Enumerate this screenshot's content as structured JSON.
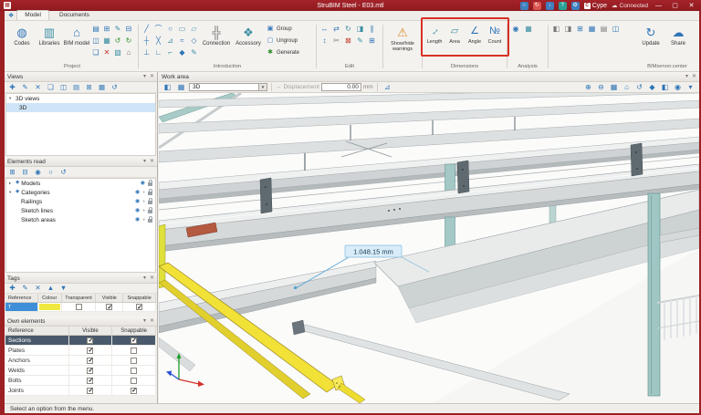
{
  "window": {
    "title": "StruBIM Steel - E03.mtl",
    "brand": "Cype",
    "connection": "Connected",
    "minimize": "—",
    "maximize": "▢",
    "close": "✕"
  },
  "tabs": {
    "model": "Model",
    "documents": "Documents"
  },
  "icons": {
    "codes": "◍",
    "libraries": "▥",
    "bim_model": "⌂",
    "connection": "╬",
    "accessory": "❖",
    "group": "▣",
    "ungroup": "▢",
    "generate": "✱",
    "warnings": "⚠",
    "length": "↔",
    "area": "▱",
    "angle": "∠",
    "count": "№",
    "update": "↻",
    "share": "☁"
  },
  "ribbon": {
    "project": {
      "label": "Project",
      "codes": "Codes",
      "libraries": "Libraries",
      "bim_model": "BIM model"
    },
    "introduction": {
      "label": "Introduction",
      "connection": "Connection",
      "accessory": "Accessory",
      "group": "Group",
      "ungroup": "Ungroup",
      "generate": "Generate"
    },
    "edit": {
      "label": "Edit"
    },
    "warnings": {
      "label": "Show/hide warnings"
    },
    "dimensions": {
      "label": "Dimensions",
      "length": "Length",
      "area": "Area",
      "angle": "Angle",
      "count": "Count",
      "highlight_color": "#d93025"
    },
    "analysis": {
      "label": "Analysis"
    },
    "bimserver": {
      "label": "BIMserver.center",
      "update": "Update",
      "share": "Share"
    }
  },
  "views_panel": {
    "title": "Views",
    "group_label": "3D views",
    "item_3d": "3D"
  },
  "elements_read_panel": {
    "title": "Elements read",
    "models": "Models",
    "categories": "Categories",
    "children": [
      "Railings",
      "Sketch lines",
      "Sketch areas"
    ]
  },
  "tags_panel": {
    "title": "Tags",
    "columns": [
      "Reference",
      "Colour",
      "Transparent",
      "Visible",
      "Snappable"
    ],
    "row": {
      "reference": "T",
      "colour": "#f0e840",
      "transparent": false,
      "visible": true,
      "snappable": true
    }
  },
  "own_elements_panel": {
    "title": "Own elements",
    "columns": [
      "Reference",
      "Visible",
      "Snappable"
    ],
    "rows": [
      {
        "reference": "Sections",
        "visible": true,
        "snappable": true,
        "selected": true
      },
      {
        "reference": "Plates",
        "visible": true,
        "snappable": false
      },
      {
        "reference": "Anchors",
        "visible": true,
        "snappable": false
      },
      {
        "reference": "Welds",
        "visible": true,
        "snappable": false
      },
      {
        "reference": "Bolts",
        "visible": true,
        "snappable": false
      },
      {
        "reference": "Joints",
        "visible": true,
        "snappable": true
      }
    ]
  },
  "work_area": {
    "title": "Work area",
    "view_selector": "3D",
    "displacement_label": "Displacement",
    "displacement_value": "0.00",
    "unit": "mm",
    "dimension_annotation": "1.048.15 mm"
  },
  "status_bar": {
    "message": "Select an option from the menu."
  }
}
